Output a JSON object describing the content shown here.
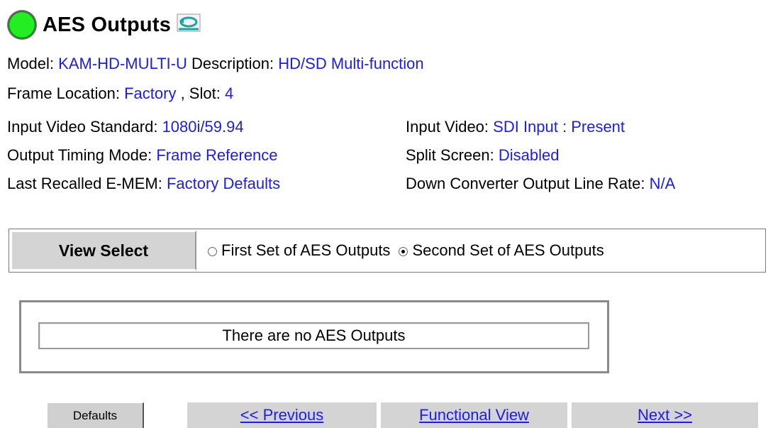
{
  "header": {
    "title": "AES Outputs",
    "status_icon": "green-status-led",
    "refresh_icon": "refresh-icon"
  },
  "info": {
    "model_label": "Model:",
    "model_value": "KAM-HD-MULTI-U",
    "description_label": "Description:",
    "description_value": "HD/SD Multi-function",
    "frame_location_label": "Frame Location:",
    "frame_location_value": "Factory",
    "slot_label": ", Slot:",
    "slot_value": "4",
    "input_standard_label": "Input Video Standard:",
    "input_standard_value": "1080i/59.94",
    "input_video_label": "Input Video:",
    "input_video_value": "SDI Input : Present",
    "output_timing_label": "Output Timing Mode:",
    "output_timing_value": "Frame Reference",
    "split_screen_label": "Split Screen:",
    "split_screen_value": "Disabled",
    "last_emem_label": "Last Recalled E-MEM:",
    "last_emem_value": "Factory Defaults",
    "down_conv_label": "Down Converter Output Line Rate:",
    "down_conv_value": "N/A"
  },
  "view_select": {
    "label": "View Select",
    "options": [
      {
        "label": "First Set of AES Outputs",
        "checked": false
      },
      {
        "label": "Second Set of AES Outputs",
        "checked": true
      }
    ]
  },
  "message": "There are no AES Outputs",
  "buttons": {
    "defaults": "Defaults",
    "previous": "<< Previous",
    "functional_view": "Functional View",
    "next": "Next >>"
  },
  "colors": {
    "value_text": "#1a1aff",
    "status_led": "#22ee22",
    "button_bg": "#d4d4d4"
  }
}
